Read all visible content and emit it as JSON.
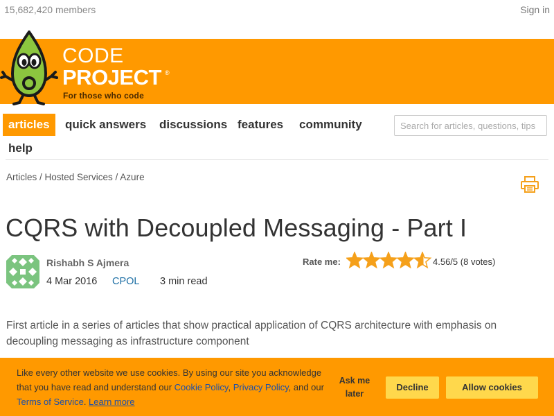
{
  "header": {
    "members": "15,682,420 members",
    "signin": "Sign in"
  },
  "logo": {
    "code": "CODE",
    "project": "PROJECT",
    "registered": "®",
    "tagline": "For those who code"
  },
  "nav": {
    "items": [
      {
        "label": "articles",
        "active": true
      },
      {
        "label": "quick answers",
        "active": false
      },
      {
        "label": "discussions",
        "active": false
      },
      {
        "label": "features",
        "active": false
      },
      {
        "label": "community",
        "active": false
      },
      {
        "label": "help",
        "active": false
      }
    ],
    "search_placeholder": "Search for articles, questions, tips"
  },
  "breadcrumb": "Articles / Hosted Services / Azure",
  "article": {
    "title": "CQRS with Decoupled Messaging - Part I",
    "author": "Rishabh S Ajmera",
    "date": "4 Mar 2016",
    "license": "CPOL",
    "read_time": "3 min read",
    "rate_label": "Rate me:",
    "rating": "4.56/5",
    "votes": "(8 votes)",
    "rating_value": 4.56,
    "summary": "First article in a series of articles that show practical application of CQRS architecture with emphasis on decoupling messaging as infrastructure component"
  },
  "cookie": {
    "text_1": "Like every other website we use cookies. By using our site you acknowledge that you have read and understand our ",
    "cookie_policy": "Cookie Policy",
    "comma": ", ",
    "privacy_policy": "Privacy Policy",
    "and_our": ", and our ",
    "terms": "Terms of Service",
    "period": ". ",
    "learn_more": "Learn more",
    "ask_later": "Ask me later",
    "decline": "Decline",
    "allow": "Allow cookies"
  },
  "colors": {
    "brand_orange": "#ff9900",
    "button_yellow": "#ffd84c",
    "link_blue": "#1c6ea4",
    "star_orange": "#f5a01a"
  },
  "icons": {
    "mascot": "bob-mascot-icon",
    "print": "print-icon",
    "avatar": "identicon-avatar",
    "star": "star-icon"
  }
}
